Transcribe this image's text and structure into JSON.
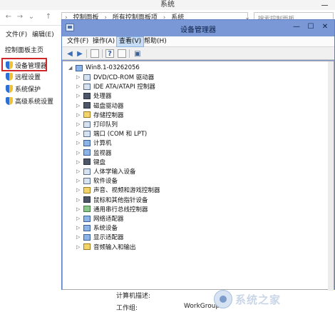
{
  "outer_window": {
    "title": "系统",
    "nav": {
      "back": "←",
      "forward": "→",
      "dropdown": "⌄",
      "up": "↑"
    },
    "breadcrumb": [
      "控制面板",
      "所有控制面板项",
      "系统"
    ],
    "breadcrumb_sep": "›",
    "refresh": "⌄",
    "search_placeholder": "搜索控制面板",
    "menu": {
      "file": "文件(F)",
      "edit": "编辑(E)"
    },
    "left_pane": {
      "home": "控制面板主页",
      "items": [
        "设备管理器",
        "远程设置",
        "系统保护",
        "高级系统设置"
      ]
    },
    "bottom": {
      "computer_desc_label": "计算机描述:",
      "workgroup_label": "工作组:",
      "workgroup_value": "WorkGroup"
    }
  },
  "device_manager": {
    "title": "设备管理器",
    "window_buttons": {
      "minimize": "—",
      "maximize": "☐",
      "close": "✕"
    },
    "menu": [
      "文件(F)",
      "操作(A)",
      "查看(V)",
      "帮助(H)"
    ],
    "active_menu_index": 2,
    "toolbar": [
      "back-arrow",
      "forward-arrow",
      "console-tree",
      "help",
      "properties",
      "scan-hardware"
    ],
    "root": "Win8.1-03262056",
    "devices": [
      "DVD/CD-ROM 驱动器",
      "IDE ATA/ATAPI 控制器",
      "处理器",
      "磁盘驱动器",
      "存储控制器",
      "打印队列",
      "端口 (COM 和 LPT)",
      "计算机",
      "监视器",
      "键盘",
      "人体学输入设备",
      "软件设备",
      "声音、视频和游戏控制器",
      "鼠标和其他指针设备",
      "通用串行总线控制器",
      "网络适配器",
      "系统设备",
      "显示适配器",
      "音频输入和输出"
    ]
  },
  "watermark": {
    "text": "系统之家"
  },
  "colors": {
    "dm_frame": "#7a98d6",
    "highlight": "#d0272c"
  }
}
